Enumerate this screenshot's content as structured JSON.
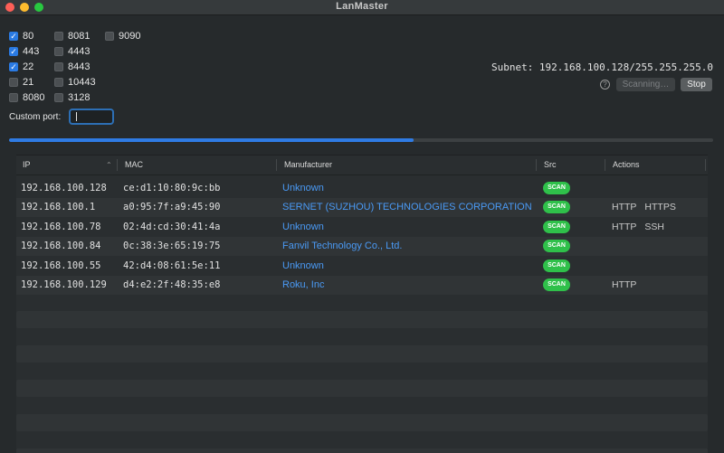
{
  "window": {
    "title": "LanMaster"
  },
  "ports": [
    {
      "label": "80",
      "checked": true
    },
    {
      "label": "8081",
      "checked": false
    },
    {
      "label": "9090",
      "checked": false
    },
    {
      "label": "443",
      "checked": true
    },
    {
      "label": "4443",
      "checked": false
    },
    {
      "label": "22",
      "checked": true
    },
    {
      "label": "8443",
      "checked": false
    },
    {
      "label": "21",
      "checked": false
    },
    {
      "label": "10443",
      "checked": false
    },
    {
      "label": "8080",
      "checked": false
    },
    {
      "label": "3128",
      "checked": false
    }
  ],
  "custom_port": {
    "label": "Custom port:",
    "value": ""
  },
  "subnet": {
    "text": "Subnet: 192.168.100.128/255.255.255.0"
  },
  "controls": {
    "help": "?",
    "scanning_label": "Scanning…",
    "stop_label": "Stop"
  },
  "progress": {
    "fraction": 0.575
  },
  "table": {
    "headers": {
      "ip": "IP",
      "mac": "MAC",
      "manufacturer": "Manufacturer",
      "src": "Src",
      "actions": "Actions"
    },
    "rows": [
      {
        "ip": "192.168.100.128",
        "mac": "ce:d1:10:80:9c:bb",
        "manufacturer": "Unknown",
        "src": "SCAN",
        "actions": []
      },
      {
        "ip": "192.168.100.1",
        "mac": "a0:95:7f:a9:45:90",
        "manufacturer": "SERNET (SUZHOU) TECHNOLOGIES CORPORATION",
        "src": "SCAN",
        "actions": [
          "HTTP",
          "HTTPS"
        ]
      },
      {
        "ip": "192.168.100.78",
        "mac": "02:4d:cd:30:41:4a",
        "manufacturer": "Unknown",
        "src": "SCAN",
        "actions": [
          "HTTP",
          "SSH"
        ]
      },
      {
        "ip": "192.168.100.84",
        "mac": "0c:38:3e:65:19:75",
        "manufacturer": "Fanvil Technology Co., Ltd.",
        "src": "SCAN",
        "actions": []
      },
      {
        "ip": "192.168.100.55",
        "mac": "42:d4:08:61:5e:11",
        "manufacturer": "Unknown",
        "src": "SCAN",
        "actions": []
      },
      {
        "ip": "192.168.100.129",
        "mac": "d4:e2:2f:48:35:e8",
        "manufacturer": "Roku, Inc",
        "src": "SCAN",
        "actions": [
          "HTTP"
        ]
      }
    ]
  },
  "colors": {
    "accent": "#2f7be3",
    "link": "#4a9af5",
    "badge": "#2fc04a",
    "background": "#262a2c"
  }
}
